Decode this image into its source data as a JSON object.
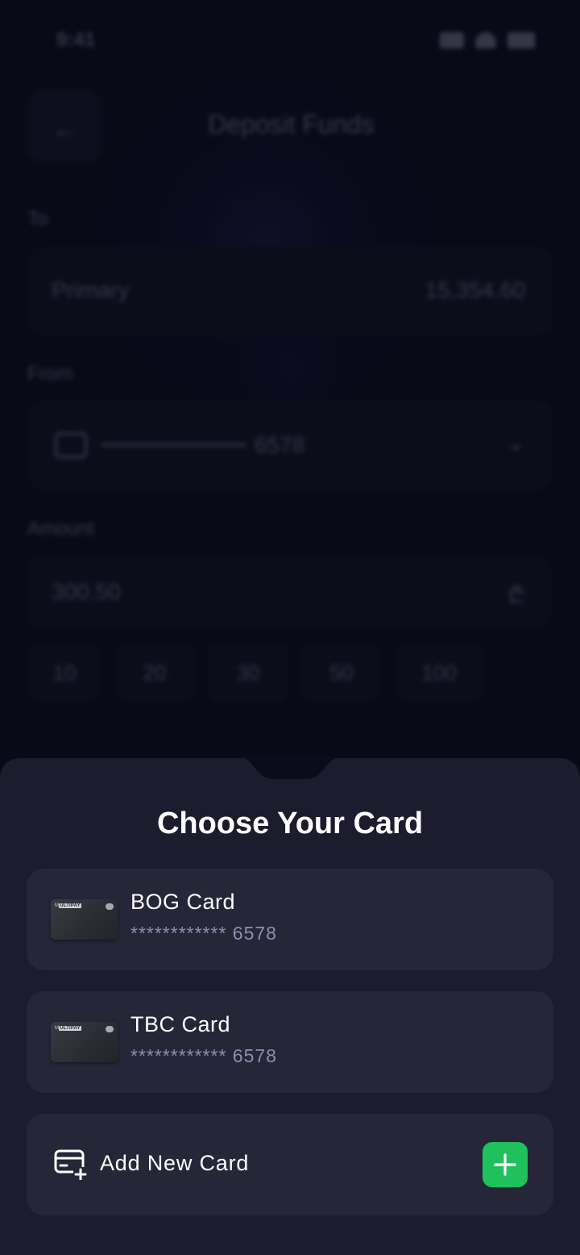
{
  "status_bar": {
    "time": "9:41"
  },
  "background": {
    "title": "Deposit Funds",
    "to_label": "To",
    "to_account": "Primary",
    "to_balance": "15,354.60",
    "from_label": "From",
    "from_card": "6578",
    "amount_label": "Amount",
    "amount_value": "300.50",
    "amount_currency": "₾",
    "quick_amounts": [
      "10",
      "20",
      "30",
      "50",
      "100"
    ]
  },
  "sheet": {
    "title": "Choose Your Card",
    "cards": [
      {
        "name": "BOG Card",
        "number": "************ 6578",
        "brand": "ULTIPAY"
      },
      {
        "name": "TBC Card",
        "number": "************ 6578",
        "brand": "ULTIPAY"
      }
    ],
    "add_new_label": "Add New Card"
  },
  "colors": {
    "accent": "#1fc15c",
    "sheet_bg": "#1c1c2e",
    "row_bg": "#262638",
    "muted_text": "#8b8fb3"
  },
  "icons": {
    "add_card": "card-plus-icon",
    "plus": "plus-icon",
    "back": "arrow-left-icon"
  }
}
